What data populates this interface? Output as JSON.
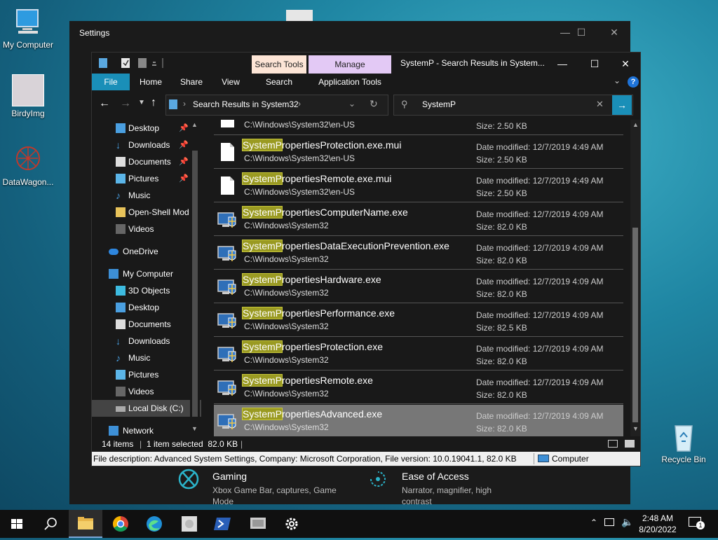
{
  "desktop": {
    "icons": [
      {
        "label": "My Computer"
      },
      {
        "label": "BirdyImg"
      },
      {
        "label": "DataWagon..."
      },
      {
        "label": "Recycle Bin"
      }
    ]
  },
  "settings": {
    "title": "Settings",
    "gaming": {
      "title": "Gaming",
      "desc": "Xbox Game Bar, captures, Game Mode"
    },
    "ease": {
      "title": "Ease of Access",
      "desc": "Narrator, magnifier, high contrast"
    }
  },
  "explorer": {
    "title": "SystemP - Search Results in System...",
    "context_tabs": {
      "search_tools": "Search Tools",
      "manage": "Manage"
    },
    "ribbon_tabs": [
      "File",
      "Home",
      "Share",
      "View",
      "Search",
      "Application Tools"
    ],
    "address": "Search Results in System32",
    "search_query": "SystemP",
    "nav": {
      "quick_access": [
        {
          "label": "Desktop",
          "pinned": true
        },
        {
          "label": "Downloads",
          "pinned": true
        },
        {
          "label": "Documents",
          "pinned": true
        },
        {
          "label": "Pictures",
          "pinned": true
        },
        {
          "label": "Music",
          "pinned": false
        },
        {
          "label": "Open-Shell Mod",
          "pinned": false
        },
        {
          "label": "Videos",
          "pinned": false
        }
      ],
      "onedrive": "OneDrive",
      "my_computer": "My Computer",
      "computer_items": [
        "3D Objects",
        "Desktop",
        "Documents",
        "Downloads",
        "Music",
        "Pictures",
        "Videos",
        "Local Disk (C:)"
      ],
      "network": "Network"
    },
    "partial_row": {
      "path": "C:\\Windows\\System32\\en-US",
      "size": "Size: 2.50 KB"
    },
    "match": "SystemP",
    "results": [
      {
        "rest": "ropertiesProtection.exe.mui",
        "path": "C:\\Windows\\System32\\en-US",
        "date": "Date modified:  12/7/2019 4:49 AM",
        "size": "Size: 2.50 KB",
        "kind": "doc"
      },
      {
        "rest": "ropertiesRemote.exe.mui",
        "path": "C:\\Windows\\System32\\en-US",
        "date": "Date modified:  12/7/2019 4:49 AM",
        "size": "Size: 2.50 KB",
        "kind": "doc"
      },
      {
        "rest": "ropertiesComputerName.exe",
        "path": "C:\\Windows\\System32",
        "date": "Date modified:  12/7/2019 4:09 AM",
        "size": "Size: 82.0 KB",
        "kind": "exe"
      },
      {
        "rest": "ropertiesDataExecutionPrevention.exe",
        "path": "C:\\Windows\\System32",
        "date": "Date modified:  12/7/2019 4:09 AM",
        "size": "Size: 82.0 KB",
        "kind": "exe"
      },
      {
        "rest": "ropertiesHardware.exe",
        "path": "C:\\Windows\\System32",
        "date": "Date modified:  12/7/2019 4:09 AM",
        "size": "Size: 82.0 KB",
        "kind": "exe"
      },
      {
        "rest": "ropertiesPerformance.exe",
        "path": "C:\\Windows\\System32",
        "date": "Date modified:  12/7/2019 4:09 AM",
        "size": "Size: 82.5 KB",
        "kind": "exe"
      },
      {
        "rest": "ropertiesProtection.exe",
        "path": "C:\\Windows\\System32",
        "date": "Date modified:  12/7/2019 4:09 AM",
        "size": "Size: 82.0 KB",
        "kind": "exe"
      },
      {
        "rest": "ropertiesRemote.exe",
        "path": "C:\\Windows\\System32",
        "date": "Date modified:  12/7/2019 4:09 AM",
        "size": "Size: 82.0 KB",
        "kind": "exe"
      },
      {
        "rest": "ropertiesAdvanced.exe",
        "path": "C:\\Windows\\System32",
        "date": "Date modified:  12/7/2019 4:09 AM",
        "size": "Size: 82.0 KB",
        "kind": "exe",
        "selected": true
      }
    ],
    "status": {
      "count": "14 items",
      "selected": "1 item selected  82.0 KB"
    },
    "description": "File description: Advanced System Settings, Company: Microsoft Corporation, File version: 10.0.19041.1, 82.0 KB",
    "zone": "Computer"
  },
  "taskbar": {
    "time": "2:48 AM",
    "date": "8/20/2022",
    "notifications": "1"
  },
  "colors": {
    "ribbon_file": "#1a8fb8",
    "search_tools_tab": "#fde5d6",
    "manage_tab": "#e3c9f5",
    "highlight": "#9a9a22",
    "selected_row": "#777777"
  }
}
